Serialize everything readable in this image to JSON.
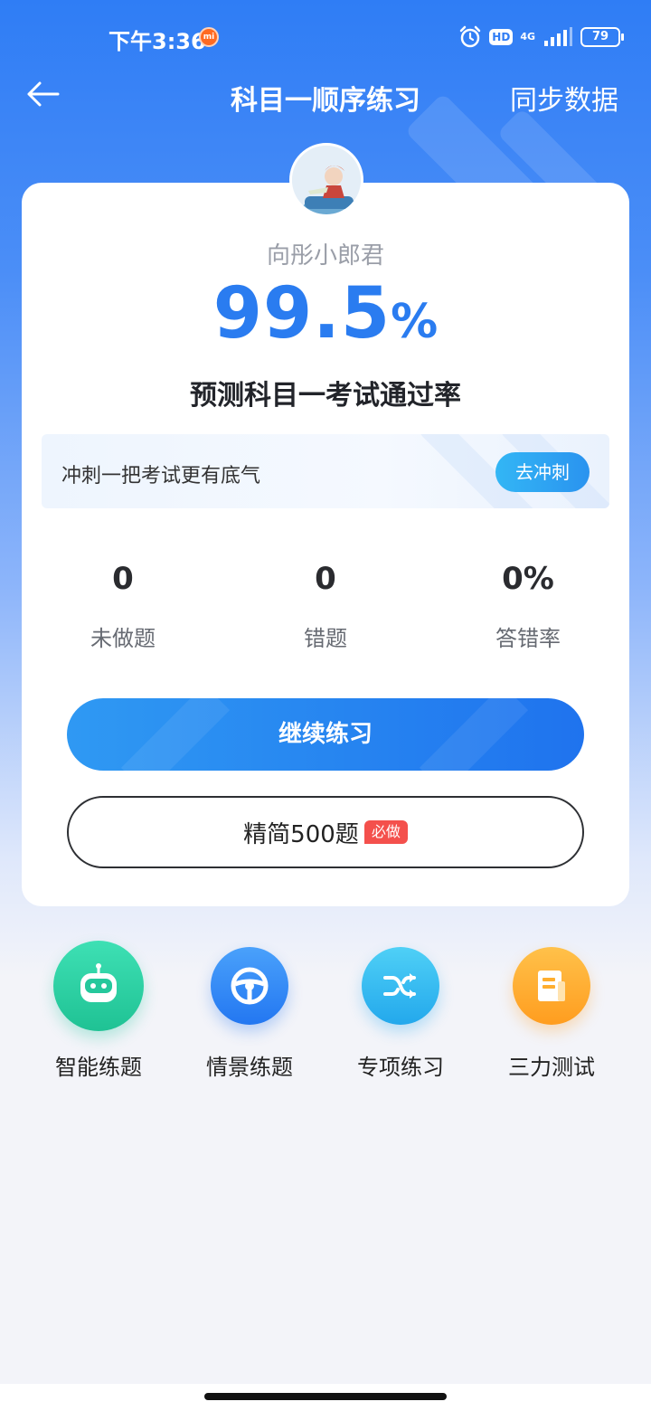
{
  "status_bar": {
    "time": "下午3:36",
    "hd": "HD",
    "network": "4G",
    "battery": "79"
  },
  "header": {
    "title": "科目一顺序练习",
    "sync_label": "同步数据"
  },
  "card": {
    "username": "向彤小郎君",
    "pass_rate_value": "99.5",
    "pass_rate_unit": "%",
    "pass_rate_label": "预测科目一考试通过率",
    "sprint": {
      "text": "冲刺一把考试更有底气",
      "button_label": "去冲刺"
    },
    "stats": [
      {
        "value": "0",
        "label": "未做题"
      },
      {
        "value": "0",
        "label": "错题"
      },
      {
        "value": "0%",
        "label": "答错率"
      }
    ],
    "continue_label": "继续练习",
    "simplified_label": "精简500题",
    "must_do_badge": "必做"
  },
  "features": [
    {
      "label": "智能练题",
      "icon": "robot-icon",
      "color": "#2fd3a6"
    },
    {
      "label": "情景练题",
      "icon": "steering-wheel-icon",
      "color": "#2f86f6"
    },
    {
      "label": "专项练习",
      "icon": "shuffle-icon",
      "color": "#35b9f1"
    },
    {
      "label": "三力测试",
      "icon": "document-icon",
      "color": "#ffa726"
    }
  ]
}
